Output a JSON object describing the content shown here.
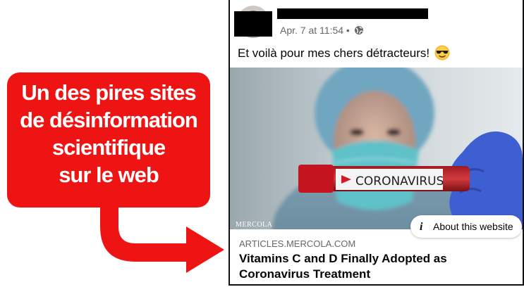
{
  "callout": {
    "lines": [
      "Un des pires sites",
      "de désinformation",
      "scientifique",
      "sur le web"
    ],
    "background_color": "#ef1414",
    "text_color": "#ffffff"
  },
  "post": {
    "timestamp": "Apr. 7 at 11:54",
    "separator": "•",
    "audience_icon": "globe-icon",
    "text": "Et voilà pour mes chers détracteurs!",
    "emoji": "sunglasses-emoji",
    "image_label": "CORONAVIRUS",
    "image_credit": "MERCOLA",
    "about_label": "About this website",
    "about_icon": "info-icon",
    "link": {
      "domain": "ARTICLES.MERCOLA.COM",
      "title": "Vitamins C and D Finally Adopted as Coronavirus Treatment"
    }
  }
}
